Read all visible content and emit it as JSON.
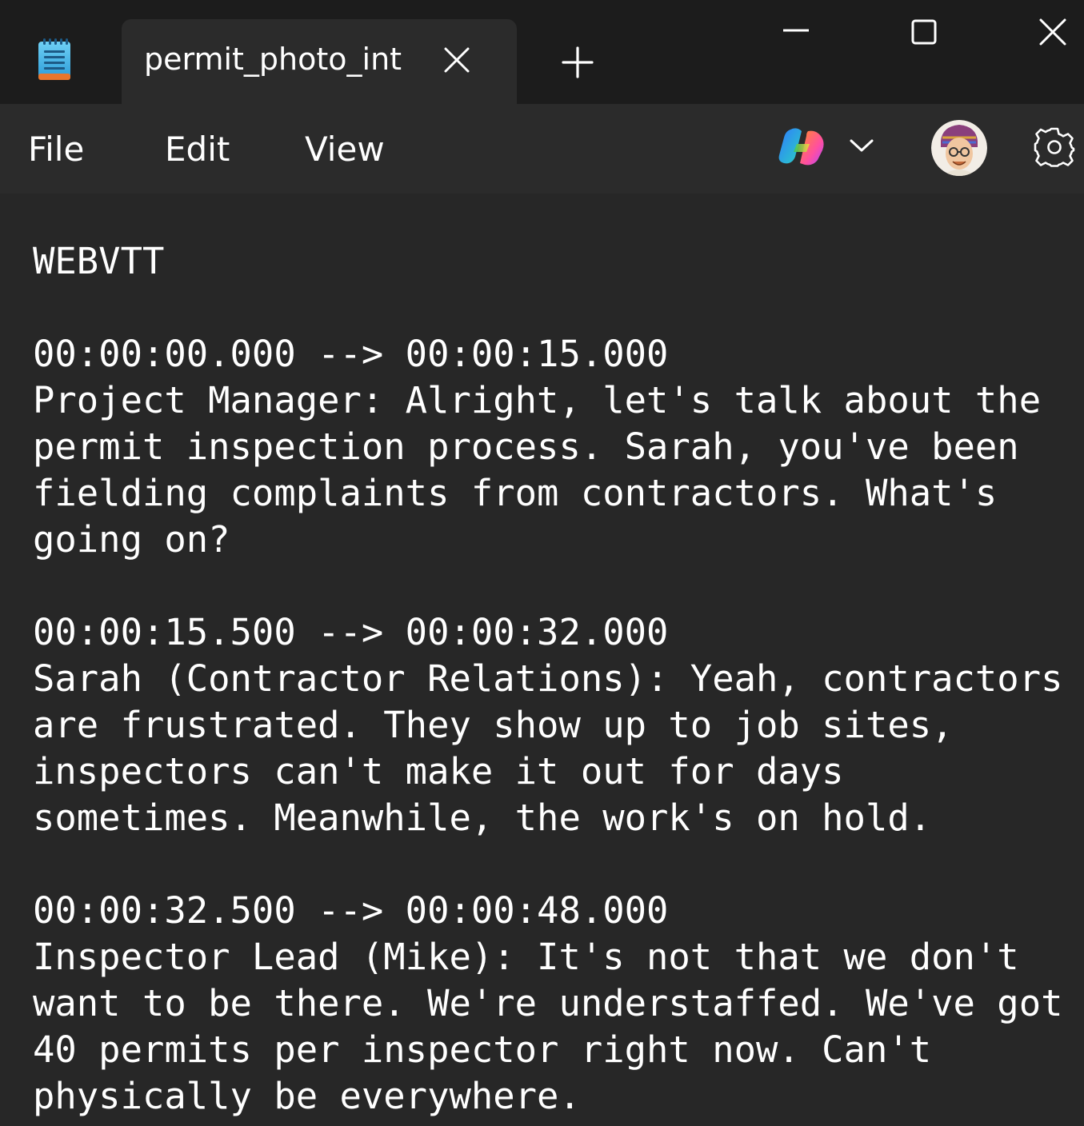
{
  "window": {
    "tab_title": "permit_photo_int"
  },
  "menu": {
    "file": "File",
    "edit": "Edit",
    "view": "View"
  },
  "icons": {
    "app": "notepad-icon",
    "tab_close": "close-icon",
    "new_tab": "plus-icon",
    "minimize": "minimize-icon",
    "maximize": "maximize-icon",
    "close": "close-icon",
    "copilot": "copilot-icon",
    "dropdown": "chevron-down-icon",
    "account": "avatar",
    "settings": "gear-icon"
  },
  "colors": {
    "titlebar": "#1c1c1c",
    "tab_active": "#2b2b2b",
    "editor_bg": "#272727",
    "text": "#ffffff"
  },
  "editor": {
    "content": "WEBVTT\n\n00:00:00.000 --> 00:00:15.000\nProject Manager: Alright, let's talk about the\npermit inspection process. Sarah, you've been\nfielding complaints from contractors. What's\ngoing on?\n\n00:00:15.500 --> 00:00:32.000\nSarah (Contractor Relations): Yeah, contractors\nare frustrated. They show up to job sites,\ninspectors can't make it out for days\nsometimes. Meanwhile, the work's on hold.\n\n00:00:32.500 --> 00:00:48.000\nInspector Lead (Mike): It's not that we don't\nwant to be there. We're understaffed. We've got\n40 permits per inspector right now. Can't\nphysically be everywhere."
  }
}
